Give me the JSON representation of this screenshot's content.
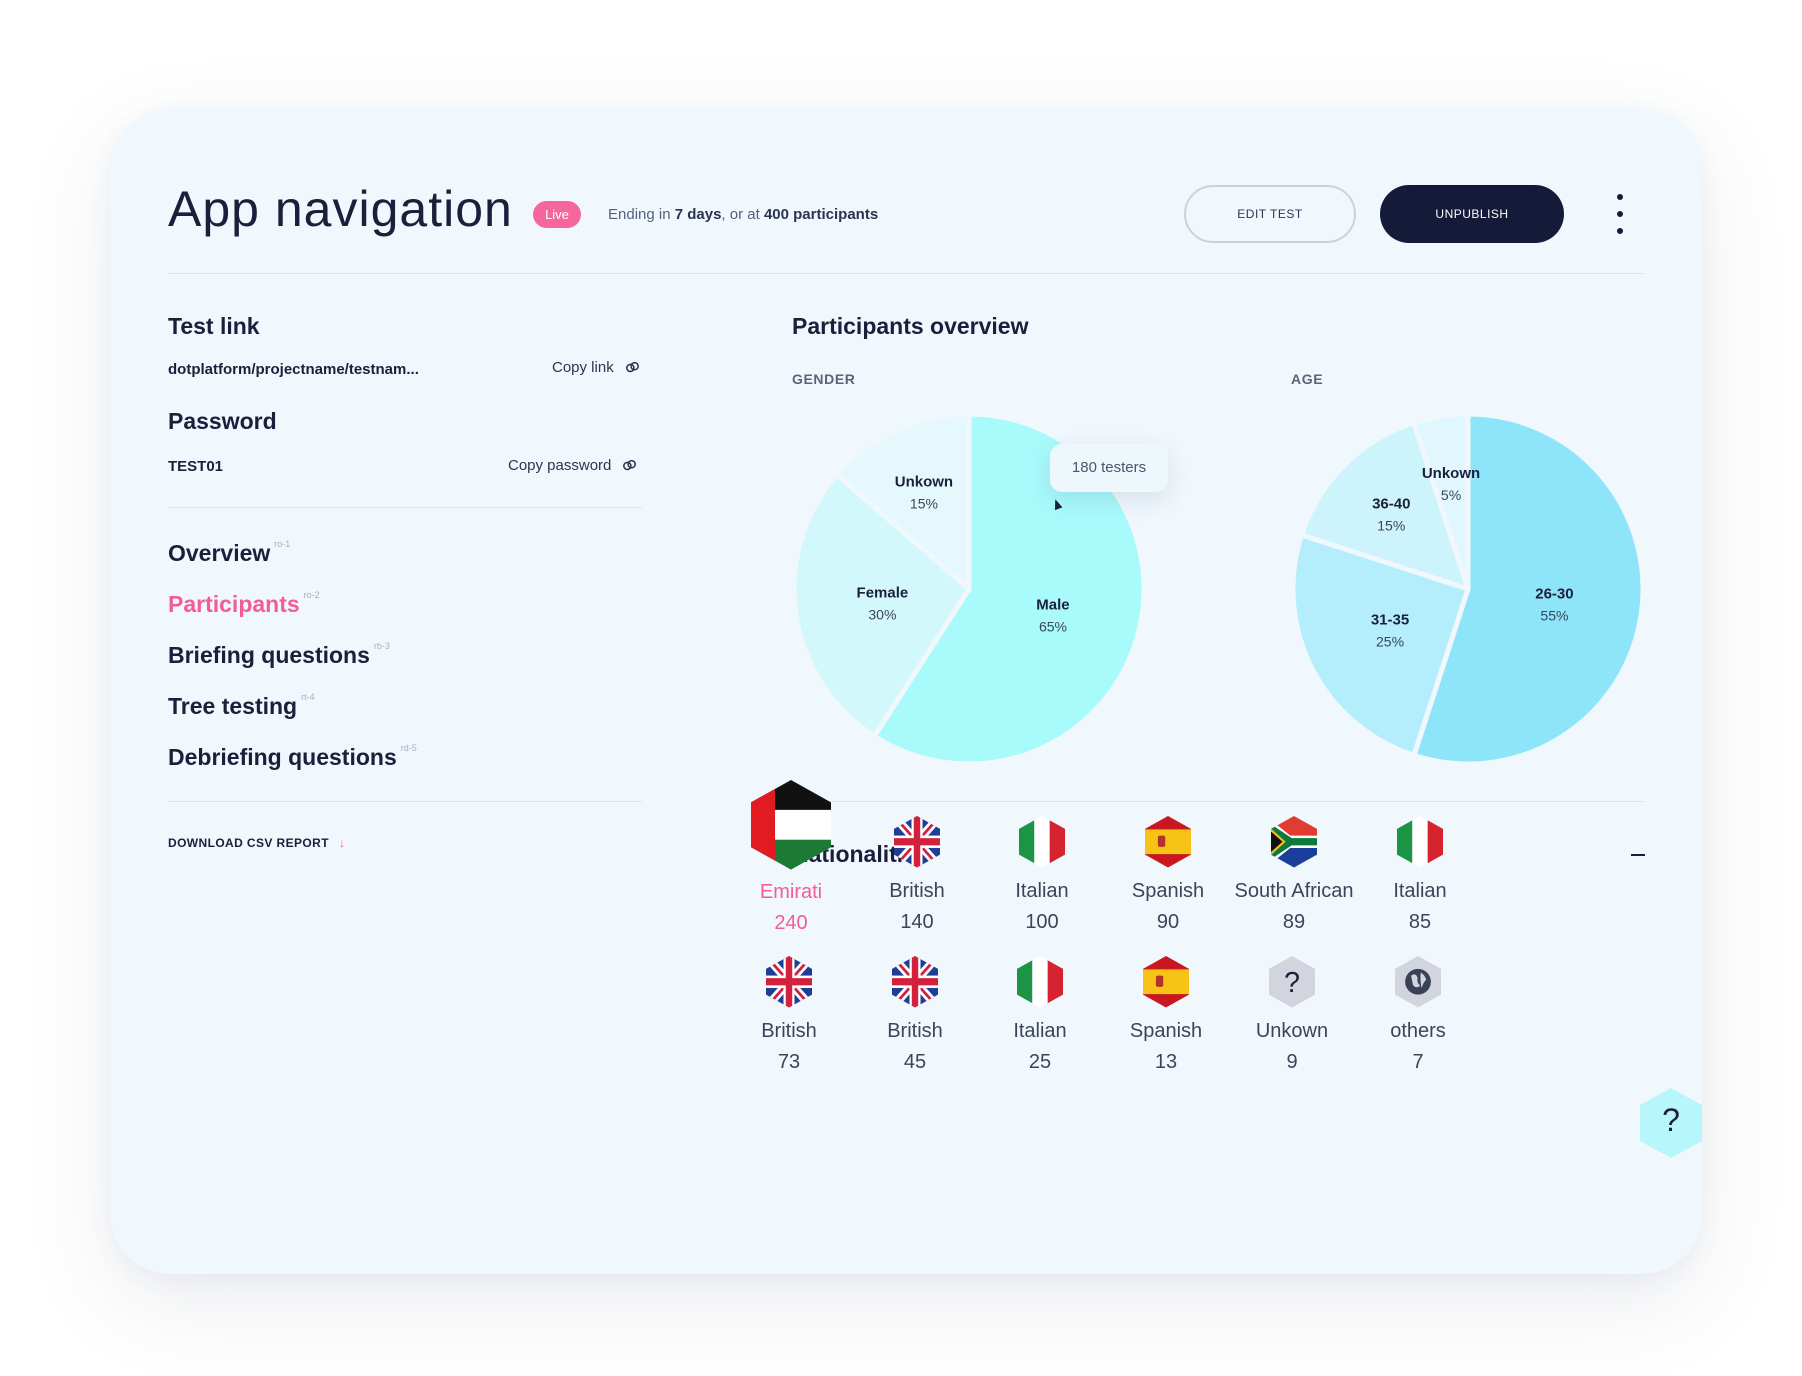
{
  "header": {
    "title": "App navigation",
    "status_badge": "Live",
    "ending_prefix": "Ending in ",
    "ending_days": "7 days",
    "ending_mid": ", or at ",
    "ending_participants": "400 participants",
    "edit_button": "EDIT TEST",
    "unpublish_button": "UNPUBLISH"
  },
  "test_link": {
    "heading": "Test link",
    "value": "dotplatform/projectname/testnam...",
    "copy_label": "Copy link"
  },
  "password": {
    "heading": "Password",
    "value": "TEST01",
    "copy_label": "Copy password"
  },
  "nav": [
    {
      "label": "Overview",
      "tag": "ro-1",
      "active": false
    },
    {
      "label": "Participants",
      "tag": "ro-2",
      "active": true
    },
    {
      "label": "Briefing questions",
      "tag": "rb-3",
      "active": false
    },
    {
      "label": "Tree testing",
      "tag": "rt-4",
      "active": false
    },
    {
      "label": "Debriefing questions",
      "tag": "rd-5",
      "active": false
    }
  ],
  "download_label": "DOWNLOAD CSV REPORT",
  "participants": {
    "heading": "Participants overview",
    "gender_label": "GENDER",
    "age_label": "AGE",
    "tooltip": "180 testers"
  },
  "chart_data": [
    {
      "type": "pie",
      "title": "GENDER",
      "slices": [
        {
          "label": "Male",
          "value": 65,
          "display": "65%",
          "color": "#a8fafb"
        },
        {
          "label": "Female",
          "value": 30,
          "display": "30%",
          "color": "#d2f8fb"
        },
        {
          "label": "Unkown",
          "value": 15,
          "display": "15%",
          "color": "#e5f8fc"
        }
      ]
    },
    {
      "type": "pie",
      "title": "AGE",
      "slices": [
        {
          "label": "26-30",
          "value": 55,
          "display": "55%",
          "color": "#8ee5fa"
        },
        {
          "label": "31-35",
          "value": 25,
          "display": "25%",
          "color": "#b4eefc"
        },
        {
          "label": "36-40",
          "value": 15,
          "display": "15%",
          "color": "#cdf3fd"
        },
        {
          "label": "Unkown",
          "value": 5,
          "display": "5%",
          "color": "#e0f7fd"
        }
      ]
    }
  ],
  "nationalities": {
    "heading": "Nationalities",
    "items": [
      {
        "name": "Emirati",
        "count": "240",
        "flag": "uae-flag-icon",
        "highlight": true
      },
      {
        "name": "British",
        "count": "140",
        "flag": "uk-flag-icon",
        "highlight": false
      },
      {
        "name": "Italian",
        "count": "100",
        "flag": "italy-flag-icon",
        "highlight": false
      },
      {
        "name": "Spanish",
        "count": "90",
        "flag": "spain-flag-icon",
        "highlight": false
      },
      {
        "name": "South African",
        "count": "89",
        "flag": "south-africa-flag-icon",
        "highlight": false
      },
      {
        "name": "Italian",
        "count": "85",
        "flag": "italy-flag-icon",
        "highlight": false
      },
      {
        "name": "British",
        "count": "73",
        "flag": "uk-flag-icon",
        "highlight": false
      },
      {
        "name": "British",
        "count": "45",
        "flag": "uk-flag-icon",
        "highlight": false
      },
      {
        "name": "Italian",
        "count": "25",
        "flag": "italy-flag-icon",
        "highlight": false
      },
      {
        "name": "Spanish",
        "count": "13",
        "flag": "spain-flag-icon",
        "highlight": false
      },
      {
        "name": "Unkown",
        "count": "9",
        "flag": "unknown-flag-icon",
        "highlight": false
      },
      {
        "name": "others",
        "count": "7",
        "flag": "globe-icon",
        "highlight": false
      }
    ]
  },
  "help_label": "?"
}
